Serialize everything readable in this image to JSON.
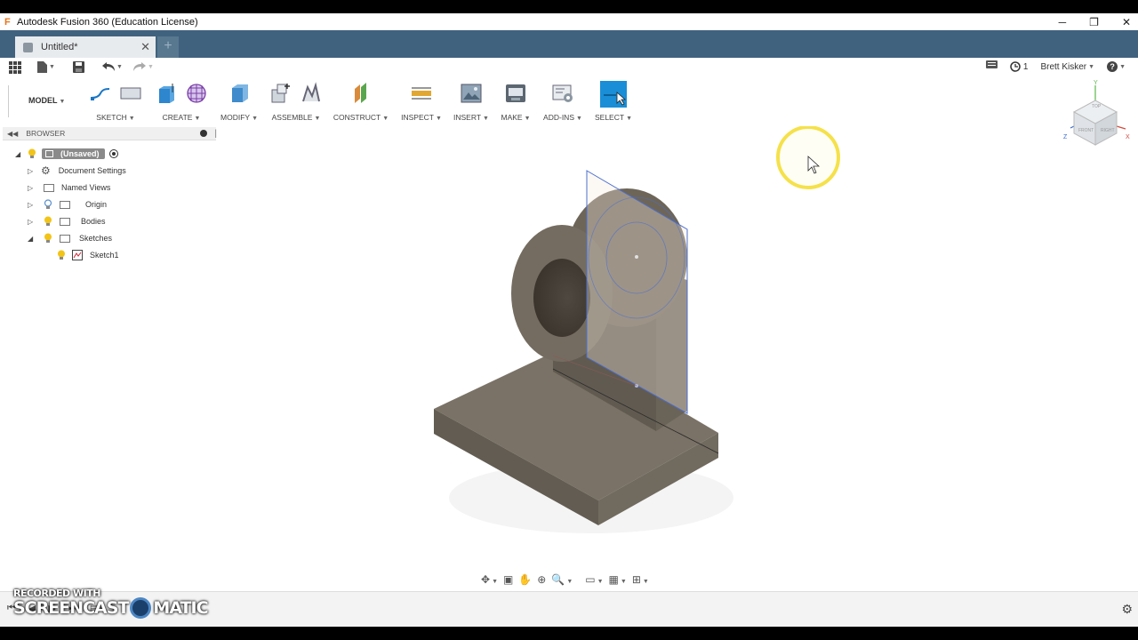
{
  "window": {
    "title": "Autodesk Fusion 360 (Education License)",
    "app_icon_letter": "F",
    "minimize": "─",
    "restore": "❐",
    "close": "✕"
  },
  "tabs": {
    "doc_name": "Untitled*",
    "close": "✕",
    "new_tab": "+"
  },
  "quickbar": {
    "history_count": "1",
    "user": "Brett Kisker",
    "help": "?"
  },
  "toolbar": {
    "mode": "MODEL",
    "groups": [
      "SKETCH",
      "CREATE",
      "MODIFY",
      "ASSEMBLE",
      "CONSTRUCT",
      "INSPECT",
      "INSERT",
      "MAKE",
      "ADD-INS",
      "SELECT"
    ]
  },
  "browser": {
    "title": "BROWSER",
    "root": "(Unsaved)",
    "items": [
      "Document Settings",
      "Named Views",
      "Origin",
      "Bodies",
      "Sketches",
      "Sketch1"
    ]
  },
  "viewcube": {
    "top": "TOP",
    "front": "FRONT",
    "right": "RIGHT",
    "axis_y": "Y",
    "axis_z": "Z",
    "axis_x": "X"
  },
  "watermark": {
    "line1": "RECORDED WITH",
    "line2": "SCREENCAST",
    "line3": "MATIC"
  },
  "colors": {
    "tab_bar": "#40627e",
    "select_accent": "#1a8ed6",
    "model_body": "#6d6558",
    "sketch_plane": "#f7ece0",
    "cursor_highlight": "#f5e14a"
  }
}
